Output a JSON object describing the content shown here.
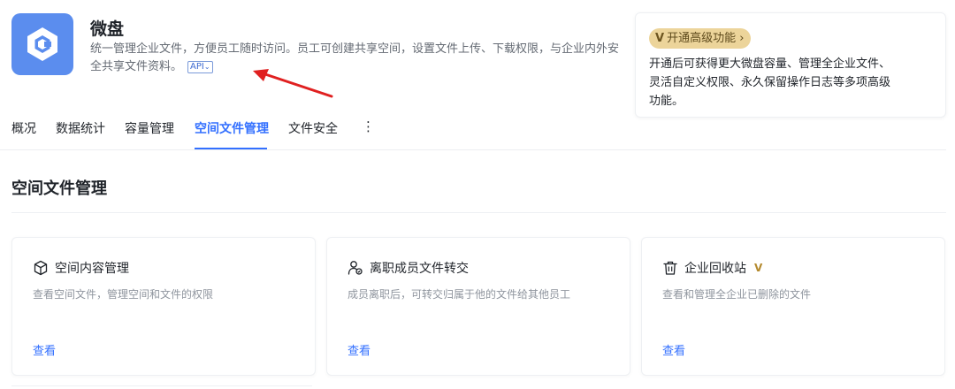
{
  "app": {
    "name": "微盘",
    "description": "统一管理企业文件，方便员工随时访问。员工可创建共享空间，设置文件上传、下载权限，与企业内外安全共享文件资料。",
    "api_tag": "API",
    "logo_icon": "weipan-logo-icon"
  },
  "promo": {
    "badge_mark": "V",
    "button_label": "开通高级功能 ›",
    "text": "开通后可获得更大微盘容量、管理全企业文件、灵活自定义权限、永久保留操作日志等多项高级功能。"
  },
  "tabs": [
    {
      "label": "概况"
    },
    {
      "label": "数据统计"
    },
    {
      "label": "容量管理"
    },
    {
      "label": "空间文件管理",
      "active": true
    },
    {
      "label": "文件安全"
    }
  ],
  "tabs_more": "⋮",
  "section": {
    "title": "空间文件管理"
  },
  "cards": [
    {
      "icon": "cube-icon",
      "title": "空间内容管理",
      "desc": "查看空间文件，管理空间和文件的权限",
      "link": "查看"
    },
    {
      "icon": "user-transfer-icon",
      "title": "离职成员文件转交",
      "desc": "成员离职后，可转交归属于他的文件给其他员工",
      "link": "查看"
    },
    {
      "icon": "trash-icon",
      "title": "企业回收站",
      "vip": "V",
      "desc": "查看和管理全企业已删除的文件",
      "link": "查看"
    }
  ],
  "colors": {
    "accent": "#3370ff",
    "logo_bg": "#5b8dee",
    "promo_badge": "#ecd49a",
    "annotation_arrow": "#e02020"
  }
}
